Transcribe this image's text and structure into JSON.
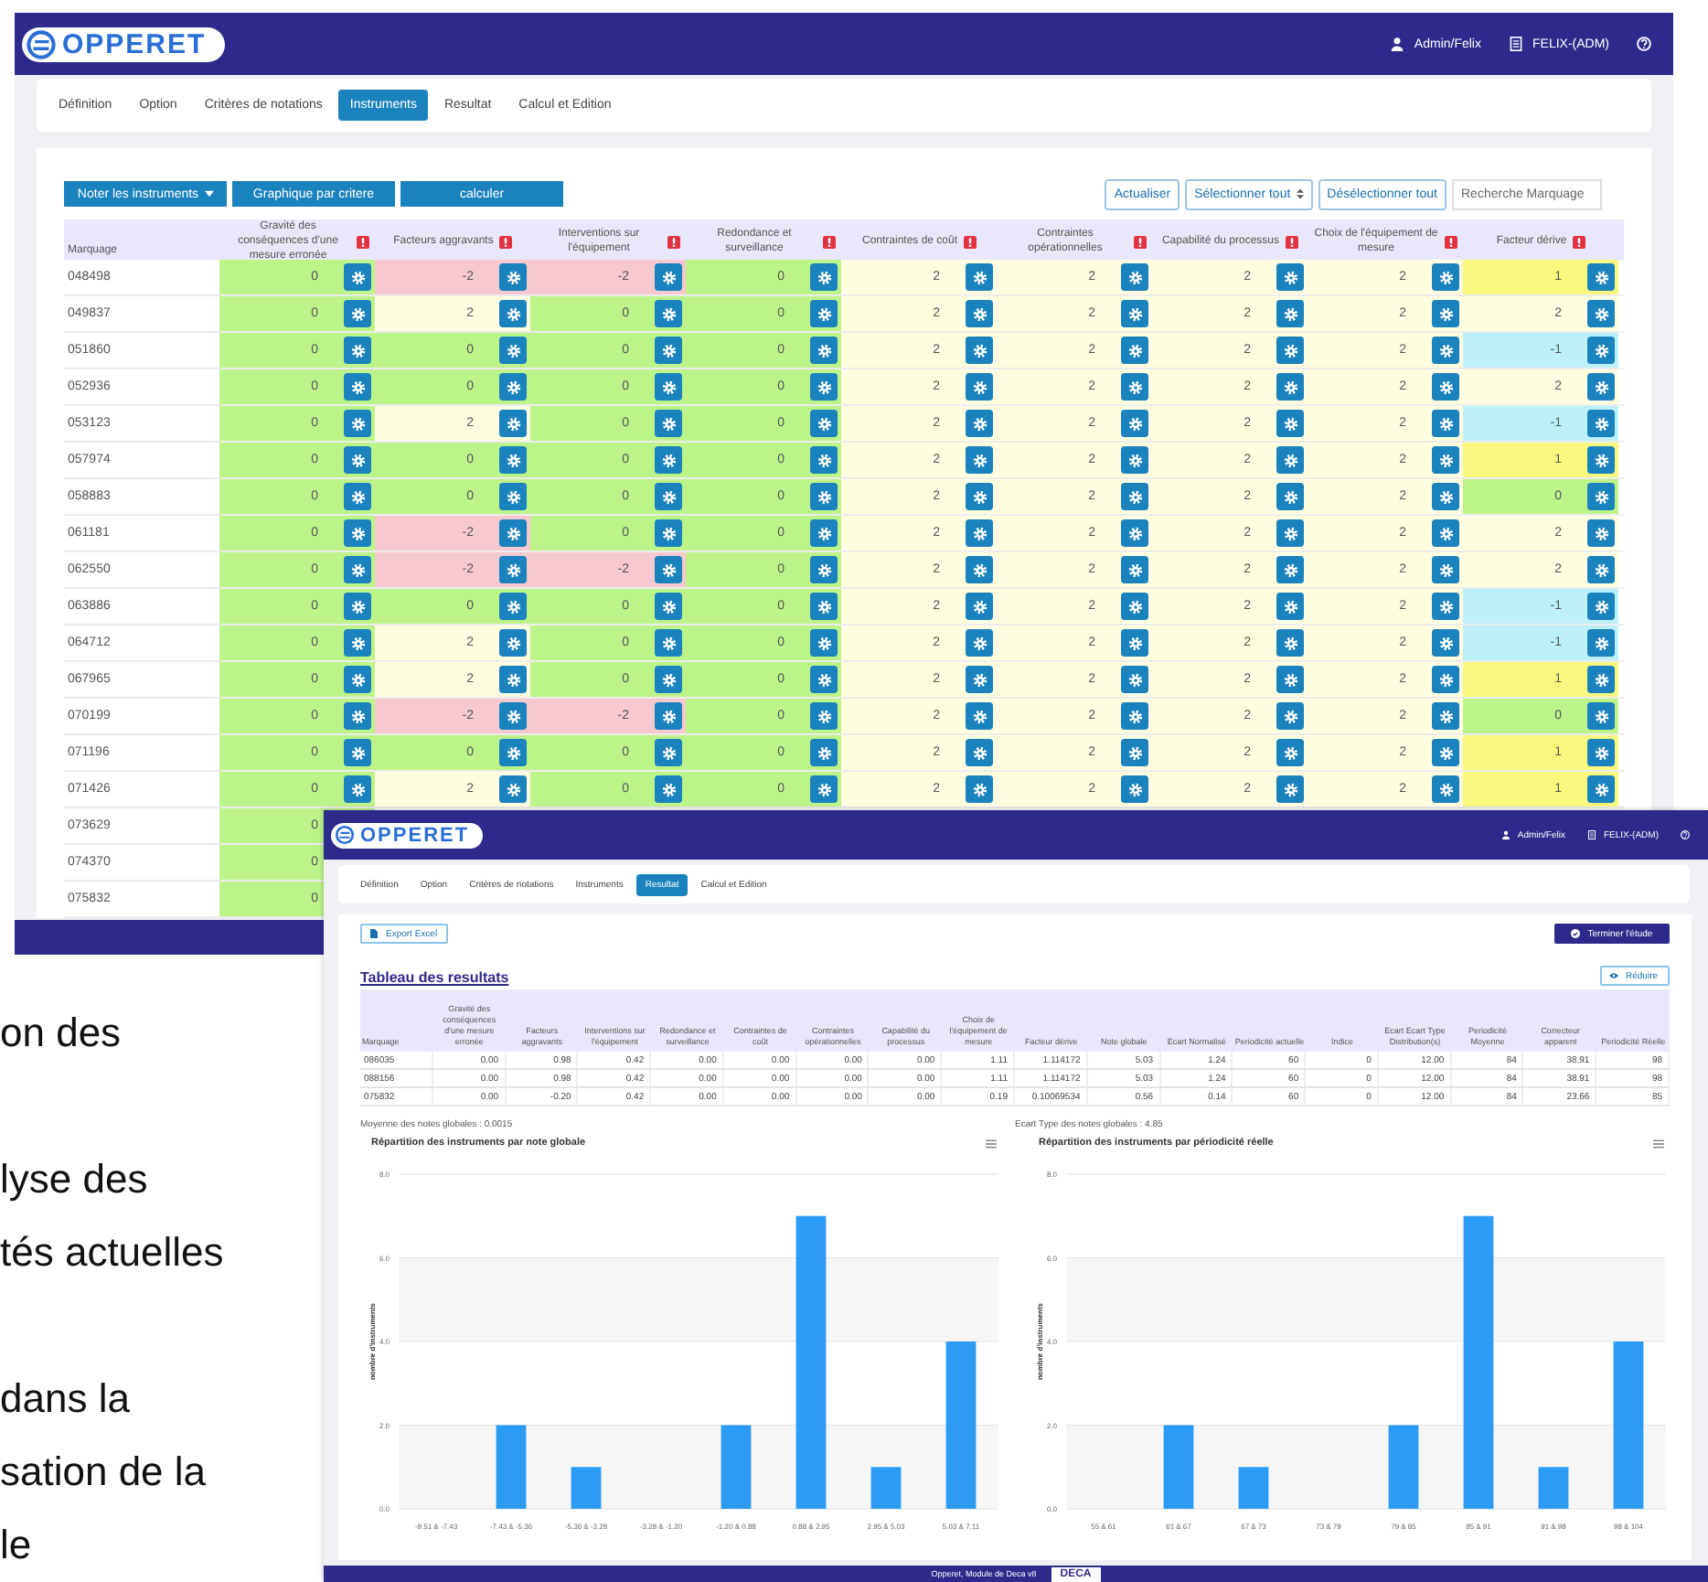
{
  "document_text": {
    "paragraphs": [
      [
        "on des"
      ],
      [
        "lyse des",
        "tés actuelles"
      ],
      [
        "dans la",
        "sation de la",
        "le"
      ]
    ]
  },
  "instruments_screen": {
    "header": {
      "logo": "OPPERET",
      "user": "Admin/Felix",
      "account": "FELIX-(ADM)"
    },
    "tabs": [
      {
        "label": "Définition",
        "selected": false
      },
      {
        "label": "Option",
        "selected": false
      },
      {
        "label": "Critères de notations",
        "selected": false
      },
      {
        "label": "Instruments",
        "selected": true
      },
      {
        "label": "Resultat",
        "selected": false
      },
      {
        "label": "Calcul et Edition",
        "selected": false
      }
    ],
    "toolbar": [
      {
        "label": "Noter les instruments",
        "kind": "primary",
        "dropdown": true
      },
      {
        "label": "Graphique par critere",
        "kind": "primary",
        "dropdown": false
      },
      {
        "label": "calculer",
        "kind": "primary",
        "dropdown": false
      },
      {
        "label": "Actualiser",
        "kind": "outline",
        "dropdown": false
      },
      {
        "label": "Sélectionner tout",
        "kind": "outline",
        "dropdown": true
      },
      {
        "label": "Désélectionner tout",
        "kind": "outline",
        "dropdown": false
      }
    ],
    "search": {
      "placeholder": "Recherche Marquage"
    },
    "table": {
      "columns": [
        "Marquage",
        "Gravité des conséquences d'une mesure erronée",
        "Facteurs aggravants",
        "Interventions sur l'équipement",
        "Redondance et surveillance",
        "Contraintes de coût",
        "Contraintes opérationnelles",
        "Capabilité du processus",
        "Choix de l'équipement de mesure",
        "Facteur dérive"
      ],
      "rows": [
        {
          "cells": [
            {
              "kind": "label",
              "value": "048498"
            },
            {
              "kind": "score",
              "value": "0",
              "color": "#bdf48a"
            },
            {
              "kind": "score",
              "value": "-2",
              "color": "#f6c9d0"
            },
            {
              "kind": "score",
              "value": "-2",
              "color": "#f6c9d0"
            },
            {
              "kind": "score",
              "value": "0",
              "color": "#bdf48a"
            },
            {
              "kind": "score",
              "value": "2",
              "color": "#fffde0"
            },
            {
              "kind": "score",
              "value": "2",
              "color": "#fffde0"
            },
            {
              "kind": "score",
              "value": "2",
              "color": "#fffde0"
            },
            {
              "kind": "score",
              "value": "2",
              "color": "#fffde0"
            },
            {
              "kind": "score",
              "value": "1",
              "color": "#f8f87e"
            }
          ]
        },
        {
          "cells": [
            {
              "kind": "label",
              "value": "049837"
            },
            {
              "kind": "score",
              "value": "0",
              "color": "#bdf48a"
            },
            {
              "kind": "score",
              "value": "2",
              "color": "#fffde0"
            },
            {
              "kind": "score",
              "value": "0",
              "color": "#bdf48a"
            },
            {
              "kind": "score",
              "value": "0",
              "color": "#bdf48a"
            },
            {
              "kind": "score",
              "value": "2",
              "color": "#fffde0"
            },
            {
              "kind": "score",
              "value": "2",
              "color": "#fffde0"
            },
            {
              "kind": "score",
              "value": "2",
              "color": "#fffde0"
            },
            {
              "kind": "score",
              "value": "2",
              "color": "#fffde0"
            },
            {
              "kind": "score",
              "value": "2",
              "color": "#fffde0"
            }
          ]
        },
        {
          "cells": [
            {
              "kind": "label",
              "value": "051860"
            },
            {
              "kind": "score",
              "value": "0",
              "color": "#bdf48a"
            },
            {
              "kind": "score",
              "value": "0",
              "color": "#bdf48a"
            },
            {
              "kind": "score",
              "value": "0",
              "color": "#bdf48a"
            },
            {
              "kind": "score",
              "value": "0",
              "color": "#bdf48a"
            },
            {
              "kind": "score",
              "value": "2",
              "color": "#fffde0"
            },
            {
              "kind": "score",
              "value": "2",
              "color": "#fffde0"
            },
            {
              "kind": "score",
              "value": "2",
              "color": "#fffde0"
            },
            {
              "kind": "score",
              "value": "2",
              "color": "#fffde0"
            },
            {
              "kind": "score",
              "value": "-1",
              "color": "#bdf0f8"
            }
          ]
        },
        {
          "cells": [
            {
              "kind": "label",
              "value": "052936"
            },
            {
              "kind": "score",
              "value": "0",
              "color": "#bdf48a"
            },
            {
              "kind": "score",
              "value": "0",
              "color": "#bdf48a"
            },
            {
              "kind": "score",
              "value": "0",
              "color": "#bdf48a"
            },
            {
              "kind": "score",
              "value": "0",
              "color": "#bdf48a"
            },
            {
              "kind": "score",
              "value": "2",
              "color": "#fffde0"
            },
            {
              "kind": "score",
              "value": "2",
              "color": "#fffde0"
            },
            {
              "kind": "score",
              "value": "2",
              "color": "#fffde0"
            },
            {
              "kind": "score",
              "value": "2",
              "color": "#fffde0"
            },
            {
              "kind": "score",
              "value": "2",
              "color": "#fffde0"
            }
          ]
        },
        {
          "cells": [
            {
              "kind": "label",
              "value": "053123"
            },
            {
              "kind": "score",
              "value": "0",
              "color": "#bdf48a"
            },
            {
              "kind": "score",
              "value": "2",
              "color": "#fffde0"
            },
            {
              "kind": "score",
              "value": "0",
              "color": "#bdf48a"
            },
            {
              "kind": "score",
              "value": "0",
              "color": "#bdf48a"
            },
            {
              "kind": "score",
              "value": "2",
              "color": "#fffde0"
            },
            {
              "kind": "score",
              "value": "2",
              "color": "#fffde0"
            },
            {
              "kind": "score",
              "value": "2",
              "color": "#fffde0"
            },
            {
              "kind": "score",
              "value": "2",
              "color": "#fffde0"
            },
            {
              "kind": "score",
              "value": "-1",
              "color": "#bdf0f8"
            }
          ]
        },
        {
          "cells": [
            {
              "kind": "label",
              "value": "057974"
            },
            {
              "kind": "score",
              "value": "0",
              "color": "#bdf48a"
            },
            {
              "kind": "score",
              "value": "0",
              "color": "#bdf48a"
            },
            {
              "kind": "score",
              "value": "0",
              "color": "#bdf48a"
            },
            {
              "kind": "score",
              "value": "0",
              "color": "#bdf48a"
            },
            {
              "kind": "score",
              "value": "2",
              "color": "#fffde0"
            },
            {
              "kind": "score",
              "value": "2",
              "color": "#fffde0"
            },
            {
              "kind": "score",
              "value": "2",
              "color": "#fffde0"
            },
            {
              "kind": "score",
              "value": "2",
              "color": "#fffde0"
            },
            {
              "kind": "score",
              "value": "1",
              "color": "#f8f87e"
            }
          ]
        },
        {
          "cells": [
            {
              "kind": "label",
              "value": "058883"
            },
            {
              "kind": "score",
              "value": "0",
              "color": "#bdf48a"
            },
            {
              "kind": "score",
              "value": "0",
              "color": "#bdf48a"
            },
            {
              "kind": "score",
              "value": "0",
              "color": "#bdf48a"
            },
            {
              "kind": "score",
              "value": "0",
              "color": "#bdf48a"
            },
            {
              "kind": "score",
              "value": "2",
              "color": "#fffde0"
            },
            {
              "kind": "score",
              "value": "2",
              "color": "#fffde0"
            },
            {
              "kind": "score",
              "value": "2",
              "color": "#fffde0"
            },
            {
              "kind": "score",
              "value": "2",
              "color": "#fffde0"
            },
            {
              "kind": "score",
              "value": "0",
              "color": "#bdf48a"
            }
          ]
        },
        {
          "cells": [
            {
              "kind": "label",
              "value": "061181"
            },
            {
              "kind": "score",
              "value": "0",
              "color": "#bdf48a"
            },
            {
              "kind": "score",
              "value": "-2",
              "color": "#f6c9d0"
            },
            {
              "kind": "score",
              "value": "0",
              "color": "#bdf48a"
            },
            {
              "kind": "score",
              "value": "0",
              "color": "#bdf48a"
            },
            {
              "kind": "score",
              "value": "2",
              "color": "#fffde0"
            },
            {
              "kind": "score",
              "value": "2",
              "color": "#fffde0"
            },
            {
              "kind": "score",
              "value": "2",
              "color": "#fffde0"
            },
            {
              "kind": "score",
              "value": "2",
              "color": "#fffde0"
            },
            {
              "kind": "score",
              "value": "2",
              "color": "#fffde0"
            }
          ]
        },
        {
          "cells": [
            {
              "kind": "label",
              "value": "062550"
            },
            {
              "kind": "score",
              "value": "0",
              "color": "#bdf48a"
            },
            {
              "kind": "score",
              "value": "-2",
              "color": "#f6c9d0"
            },
            {
              "kind": "score",
              "value": "-2",
              "color": "#f6c9d0"
            },
            {
              "kind": "score",
              "value": "0",
              "color": "#bdf48a"
            },
            {
              "kind": "score",
              "value": "2",
              "color": "#fffde0"
            },
            {
              "kind": "score",
              "value": "2",
              "color": "#fffde0"
            },
            {
              "kind": "score",
              "value": "2",
              "color": "#fffde0"
            },
            {
              "kind": "score",
              "value": "2",
              "color": "#fffde0"
            },
            {
              "kind": "score",
              "value": "2",
              "color": "#fffde0"
            }
          ]
        },
        {
          "cells": [
            {
              "kind": "label",
              "value": "063886"
            },
            {
              "kind": "score",
              "value": "0",
              "color": "#bdf48a"
            },
            {
              "kind": "score",
              "value": "0",
              "color": "#bdf48a"
            },
            {
              "kind": "score",
              "value": "0",
              "color": "#bdf48a"
            },
            {
              "kind": "score",
              "value": "0",
              "color": "#bdf48a"
            },
            {
              "kind": "score",
              "value": "2",
              "color": "#fffde0"
            },
            {
              "kind": "score",
              "value": "2",
              "color": "#fffde0"
            },
            {
              "kind": "score",
              "value": "2",
              "color": "#fffde0"
            },
            {
              "kind": "score",
              "value": "2",
              "color": "#fffde0"
            },
            {
              "kind": "score",
              "value": "-1",
              "color": "#bdf0f8"
            }
          ]
        },
        {
          "cells": [
            {
              "kind": "label",
              "value": "064712"
            },
            {
              "kind": "score",
              "value": "0",
              "color": "#bdf48a"
            },
            {
              "kind": "score",
              "value": "2",
              "color": "#fffde0"
            },
            {
              "kind": "score",
              "value": "0",
              "color": "#bdf48a"
            },
            {
              "kind": "score",
              "value": "0",
              "color": "#bdf48a"
            },
            {
              "kind": "score",
              "value": "2",
              "color": "#fffde0"
            },
            {
              "kind": "score",
              "value": "2",
              "color": "#fffde0"
            },
            {
              "kind": "score",
              "value": "2",
              "color": "#fffde0"
            },
            {
              "kind": "score",
              "value": "2",
              "color": "#fffde0"
            },
            {
              "kind": "score",
              "value": "-1",
              "color": "#bdf0f8"
            }
          ]
        },
        {
          "cells": [
            {
              "kind": "label",
              "value": "067965"
            },
            {
              "kind": "score",
              "value": "0",
              "color": "#bdf48a"
            },
            {
              "kind": "score",
              "value": "2",
              "color": "#fffde0"
            },
            {
              "kind": "score",
              "value": "0",
              "color": "#bdf48a"
            },
            {
              "kind": "score",
              "value": "0",
              "color": "#bdf48a"
            },
            {
              "kind": "score",
              "value": "2",
              "color": "#fffde0"
            },
            {
              "kind": "score",
              "value": "2",
              "color": "#fffde0"
            },
            {
              "kind": "score",
              "value": "2",
              "color": "#fffde0"
            },
            {
              "kind": "score",
              "value": "2",
              "color": "#fffde0"
            },
            {
              "kind": "score",
              "value": "1",
              "color": "#f8f87e"
            }
          ]
        },
        {
          "cells": [
            {
              "kind": "label",
              "value": "070199"
            },
            {
              "kind": "score",
              "value": "0",
              "color": "#bdf48a"
            },
            {
              "kind": "score",
              "value": "-2",
              "color": "#f6c9d0"
            },
            {
              "kind": "score",
              "value": "-2",
              "color": "#f6c9d0"
            },
            {
              "kind": "score",
              "value": "0",
              "color": "#bdf48a"
            },
            {
              "kind": "score",
              "value": "2",
              "color": "#fffde0"
            },
            {
              "kind": "score",
              "value": "2",
              "color": "#fffde0"
            },
            {
              "kind": "score",
              "value": "2",
              "color": "#fffde0"
            },
            {
              "kind": "score",
              "value": "2",
              "color": "#fffde0"
            },
            {
              "kind": "score",
              "value": "0",
              "color": "#bdf48a"
            }
          ]
        },
        {
          "cells": [
            {
              "kind": "label",
              "value": "071196"
            },
            {
              "kind": "score",
              "value": "0",
              "color": "#bdf48a"
            },
            {
              "kind": "score",
              "value": "0",
              "color": "#bdf48a"
            },
            {
              "kind": "score",
              "value": "0",
              "color": "#bdf48a"
            },
            {
              "kind": "score",
              "value": "0",
              "color": "#bdf48a"
            },
            {
              "kind": "score",
              "value": "2",
              "color": "#fffde0"
            },
            {
              "kind": "score",
              "value": "2",
              "color": "#fffde0"
            },
            {
              "kind": "score",
              "value": "2",
              "color": "#fffde0"
            },
            {
              "kind": "score",
              "value": "2",
              "color": "#fffde0"
            },
            {
              "kind": "score",
              "value": "1",
              "color": "#f8f87e"
            }
          ]
        },
        {
          "cells": [
            {
              "kind": "label",
              "value": "071426"
            },
            {
              "kind": "score",
              "value": "0",
              "color": "#bdf48a"
            },
            {
              "kind": "score",
              "value": "2",
              "color": "#fffde0"
            },
            {
              "kind": "score",
              "value": "0",
              "color": "#bdf48a"
            },
            {
              "kind": "score",
              "value": "0",
              "color": "#bdf48a"
            },
            {
              "kind": "score",
              "value": "2",
              "color": "#fffde0"
            },
            {
              "kind": "score",
              "value": "2",
              "color": "#fffde0"
            },
            {
              "kind": "score",
              "value": "2",
              "color": "#fffde0"
            },
            {
              "kind": "score",
              "value": "2",
              "color": "#fffde0"
            },
            {
              "kind": "score",
              "value": "1",
              "color": "#f8f87e"
            }
          ]
        },
        {
          "cells": [
            {
              "kind": "label",
              "value": "073629"
            },
            {
              "kind": "value",
              "value": "0",
              "color": "#bdf48a"
            }
          ]
        },
        {
          "cells": [
            {
              "kind": "label",
              "value": "074370"
            },
            {
              "kind": "value",
              "value": "0",
              "color": "#bdf48a"
            }
          ]
        },
        {
          "cells": [
            {
              "kind": "label",
              "value": "075832"
            },
            {
              "kind": "value",
              "value": "0",
              "color": "#bdf48a"
            }
          ]
        }
      ]
    }
  },
  "results_screen": {
    "header": {
      "logo": "OPPERET",
      "user": "Admin/Felix",
      "account": "FELIX-(ADM)"
    },
    "tabs": [
      {
        "label": "Définition",
        "selected": false
      },
      {
        "label": "Option",
        "selected": false
      },
      {
        "label": "Critères de notations",
        "selected": false
      },
      {
        "label": "Instruments",
        "selected": false
      },
      {
        "label": "Resultat",
        "selected": true
      },
      {
        "label": "Calcul et Edition",
        "selected": false
      }
    ],
    "export_button": {
      "label": "Export Excel"
    },
    "finish_button": {
      "label": "Terminer l'étude"
    },
    "title": "Tableau des resultats",
    "collapse_button": {
      "label": "Réduire"
    },
    "table": {
      "columns": [
        "Marquage",
        "Gravité des conséquences d'une mesure erronée",
        "Facteurs aggravants",
        "Interventions sur l'équipement",
        "Redondance et surveillance",
        "Contraintes de coût",
        "Contraintes opérationnelles",
        "Capabilité du processus",
        "Choix de l'équipement de mesure",
        "Facteur dérive",
        "Note globale",
        "Ecart Normalisé",
        "Periodicité actuelle",
        "Indice",
        "Ecart Ecart Type Distribution(s)",
        "Periodicité Moyenne",
        "Correcteur apparent",
        "Periodicité Réelle"
      ],
      "rows": [
        [
          "086035",
          "0.00",
          "0.98",
          "0.42",
          "0.00",
          "0.00",
          "0.00",
          "0.00",
          "1.11",
          "1.114172",
          "5.03",
          "1.24",
          "60",
          "0",
          "12.00",
          "84",
          "38.91",
          "98"
        ],
        [
          "088156",
          "0.00",
          "0.98",
          "0.42",
          "0.00",
          "0.00",
          "0.00",
          "0.00",
          "1.11",
          "1.114172",
          "5.03",
          "1.24",
          "60",
          "0",
          "12.00",
          "84",
          "38.91",
          "98"
        ],
        [
          "075832",
          "0.00",
          "-0.20",
          "0.42",
          "0.00",
          "0.00",
          "0.00",
          "0.00",
          "0.19",
          "0.10069534",
          "0.56",
          "0.14",
          "60",
          "0",
          "12.00",
          "84",
          "23.66",
          "85"
        ]
      ]
    },
    "stats": [
      "Moyenne des notes globales : 0.0015",
      "Ecart Type des notes globales : 4.85"
    ],
    "charts": [
      {
        "chart_data": {
          "type": "bar",
          "title": "Répartition des instruments par note globale",
          "ylabel": "nombre d'instruments",
          "categories": [
            "-9.51 & -7.43",
            "-7.43 & -5.36",
            "-5.36 & -3.28",
            "-3.28 & -1.20",
            "-1.20 & 0.88",
            "0.88 & 2.95",
            "2.95 & 5.03",
            "5.03 & 7.11"
          ],
          "series": [
            {
              "color": "#2b9bf4",
              "values": [
                0,
                2,
                1,
                0,
                2,
                7,
                1,
                4
              ]
            }
          ],
          "ylim": [
            0,
            8
          ],
          "yticks": [
            {
              "value": 0,
              "label": "0.0"
            },
            {
              "value": 2,
              "label": "2.0"
            },
            {
              "value": 4,
              "label": "4.0"
            },
            {
              "value": 6,
              "label": "6.0"
            },
            {
              "value": 8,
              "label": "8.0"
            }
          ],
          "grid": true
        }
      },
      {
        "chart_data": {
          "type": "bar",
          "title": "Répartition des instruments par périodicité réelle",
          "ylabel": "nombre d'instruments",
          "categories": [
            "55 & 61",
            "61 & 67",
            "67 & 73",
            "73 & 79",
            "79 & 85",
            "85 & 91",
            "91 & 98",
            "98 & 104"
          ],
          "series": [
            {
              "color": "#2b9bf4",
              "values": [
                0,
                2,
                1,
                0,
                2,
                7,
                1,
                4
              ]
            }
          ],
          "ylim": [
            0,
            8
          ],
          "yticks": [
            {
              "value": 0,
              "label": "0.0"
            },
            {
              "value": 2,
              "label": "2.0"
            },
            {
              "value": 4,
              "label": "4.0"
            },
            {
              "value": 6,
              "label": "6.0"
            },
            {
              "value": 8,
              "label": "8.0"
            }
          ],
          "grid": true
        }
      }
    ],
    "footer": {
      "text": "Opperet, Module de Deca v8",
      "logo": "DECA"
    }
  }
}
